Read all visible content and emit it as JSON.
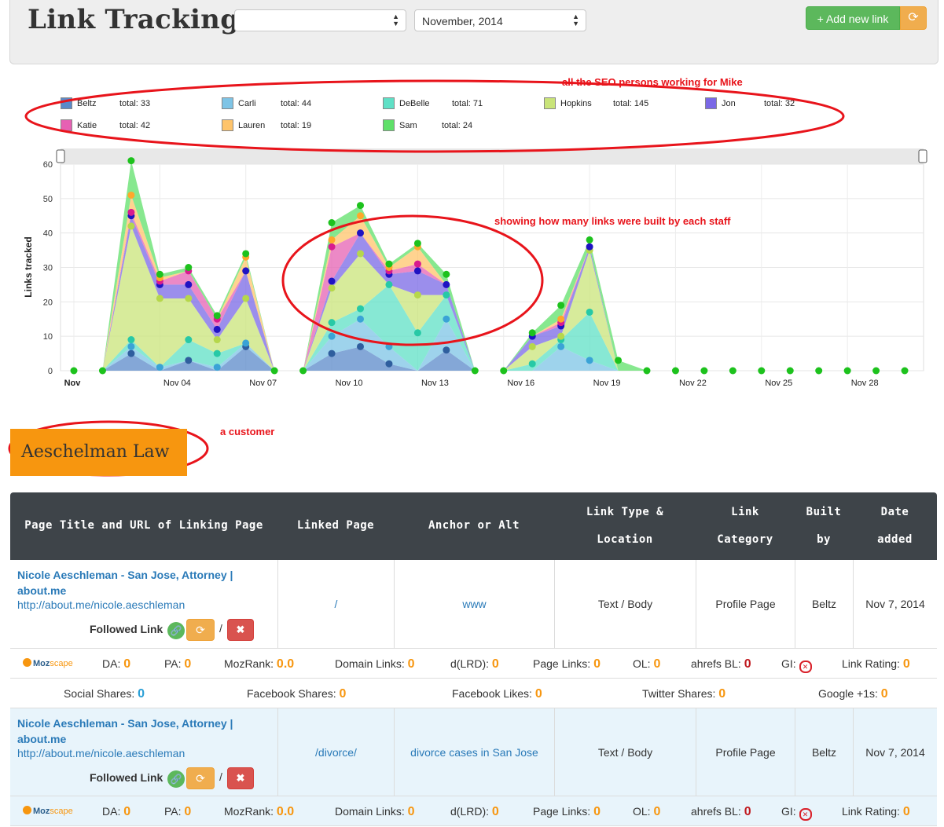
{
  "header": {
    "title": "Link Tracking",
    "select1_value": "",
    "select2_value": "November, 2014",
    "add_button": "+ Add new link",
    "refresh_icon": "refresh-icon"
  },
  "annotations": {
    "seo": "all the SEO persons working for Mike",
    "chart": "showing how many links were built by each staff",
    "customer": "a customer"
  },
  "legend": [
    {
      "name": "Beltz",
      "total": "total: 33",
      "color": "#5b8ac9"
    },
    {
      "name": "Carli",
      "total": "total: 44",
      "color": "#7ec4e6"
    },
    {
      "name": "DeBelle",
      "total": "total: 71",
      "color": "#5fe0c6"
    },
    {
      "name": "Hopkins",
      "total": "total: 145",
      "color": "#c9e479"
    },
    {
      "name": "Jon",
      "total": "total: 32",
      "color": "#7a68e6"
    },
    {
      "name": "Katie",
      "total": "total: 42",
      "color": "#e661b3"
    },
    {
      "name": "Lauren",
      "total": "total: 19",
      "color": "#ffc46b"
    },
    {
      "name": "Sam",
      "total": "total: 24",
      "color": "#5fe069"
    }
  ],
  "chart_data": {
    "type": "area",
    "stacked": true,
    "ylabel": "Links tracked",
    "ylim": [
      0,
      60
    ],
    "yticks": [
      "0",
      "10",
      "20",
      "30",
      "40",
      "50",
      "60"
    ],
    "x_labels": [
      "Nov",
      "Nov 04",
      "Nov 07",
      "Nov 10",
      "Nov 13",
      "Nov 16",
      "Nov 19",
      "Nov 22",
      "Nov 25",
      "Nov 28"
    ],
    "x": [
      "Nov 01",
      "Nov 02",
      "Nov 03",
      "Nov 04",
      "Nov 05",
      "Nov 06",
      "Nov 07",
      "Nov 08",
      "Nov 09",
      "Nov 10",
      "Nov 11",
      "Nov 12",
      "Nov 13",
      "Nov 14",
      "Nov 15",
      "Nov 16",
      "Nov 17",
      "Nov 18",
      "Nov 19",
      "Nov 20",
      "Nov 21",
      "Nov 22",
      "Nov 23",
      "Nov 24",
      "Nov 25",
      "Nov 26",
      "Nov 27",
      "Nov 28",
      "Nov 29",
      "Nov 30"
    ],
    "series": [
      {
        "name": "Beltz",
        "color": "#5b8ac9",
        "values": [
          0,
          0,
          5,
          0,
          3,
          0,
          7,
          0,
          0,
          5,
          7,
          2,
          0,
          6,
          0,
          0,
          0,
          0,
          0,
          0,
          0,
          0,
          0,
          0,
          0,
          0,
          0,
          0,
          0,
          0
        ]
      },
      {
        "name": "Carli",
        "color": "#7ec4e6",
        "values": [
          0,
          0,
          2,
          1,
          0,
          1,
          1,
          0,
          0,
          5,
          8,
          5,
          0,
          9,
          0,
          0,
          0,
          7,
          3,
          0,
          0,
          0,
          0,
          0,
          0,
          0,
          0,
          0,
          0,
          0
        ]
      },
      {
        "name": "DeBelle",
        "color": "#5fe0c6",
        "values": [
          0,
          0,
          2,
          0,
          6,
          4,
          0,
          0,
          0,
          4,
          3,
          18,
          11,
          7,
          0,
          0,
          2,
          2,
          14,
          0,
          0,
          0,
          0,
          0,
          0,
          0,
          0,
          0,
          0,
          0
        ]
      },
      {
        "name": "Hopkins",
        "color": "#c9e479",
        "values": [
          0,
          0,
          33,
          20,
          12,
          4,
          13,
          0,
          0,
          10,
          16,
          0,
          11,
          0,
          0,
          0,
          5,
          1,
          18,
          0,
          0,
          0,
          0,
          0,
          0,
          0,
          0,
          0,
          0,
          0
        ]
      },
      {
        "name": "Jon",
        "color": "#7a68e6",
        "values": [
          0,
          0,
          3,
          4,
          4,
          3,
          8,
          0,
          0,
          2,
          6,
          3,
          7,
          3,
          0,
          0,
          3,
          3,
          1,
          0,
          0,
          0,
          0,
          0,
          0,
          0,
          0,
          0,
          0,
          0
        ]
      },
      {
        "name": "Katie",
        "color": "#e661b3",
        "values": [
          0,
          0,
          1,
          1,
          4,
          3,
          0,
          0,
          0,
          10,
          0,
          1,
          2,
          0,
          0,
          0,
          0,
          1,
          0,
          0,
          0,
          0,
          0,
          0,
          0,
          0,
          0,
          0,
          0,
          0
        ]
      },
      {
        "name": "Lauren",
        "color": "#ffc46b",
        "values": [
          0,
          0,
          5,
          1,
          0,
          0,
          4,
          0,
          0,
          2,
          5,
          1,
          5,
          0,
          0,
          0,
          0,
          1,
          0,
          0,
          0,
          0,
          0,
          0,
          0,
          0,
          0,
          0,
          0,
          0
        ]
      },
      {
        "name": "Sam",
        "color": "#5fe069",
        "values": [
          0,
          0,
          10,
          1,
          1,
          1,
          1,
          0,
          0,
          5,
          3,
          1,
          1,
          3,
          0,
          0,
          1,
          4,
          2,
          3,
          0,
          0,
          0,
          0,
          0,
          0,
          0,
          0,
          0,
          0
        ]
      }
    ]
  },
  "customer": {
    "name": "Aeschelman Law"
  },
  "table": {
    "headers": [
      {
        "l1": "Page Title and URL of Linking Page",
        "l2": ""
      },
      {
        "l1": "Linked Page",
        "l2": ""
      },
      {
        "l1": "Anchor or Alt",
        "l2": ""
      },
      {
        "l1": "Link Type &",
        "l2": "Location"
      },
      {
        "l1": "Link",
        "l2": "Category"
      },
      {
        "l1": "Built",
        "l2": "by"
      },
      {
        "l1": "Date",
        "l2": "added"
      }
    ],
    "rows": [
      {
        "title_line1": "Nicole Aeschleman - San Jose, Attorney |",
        "title_line2": "about.me",
        "url": "http://about.me/nicole.aeschleman",
        "follow": "Followed Link",
        "slash": "/",
        "linked_page": "/",
        "anchor": "www",
        "link_type": "Text / Body",
        "category": "Profile Page",
        "built_by": "Beltz",
        "date": "Nov 7, 2014"
      },
      {
        "title_line1": "Nicole Aeschleman - San Jose, Attorney |",
        "title_line2": "about.me",
        "url": "http://about.me/nicole.aeschleman",
        "follow": "Followed Link",
        "slash": "/",
        "linked_page": "/divorce/",
        "anchor": "divorce cases in San Jose",
        "link_type": "Text / Body",
        "category": "Profile Page",
        "built_by": "Beltz",
        "date": "Nov 7, 2014"
      }
    ],
    "moz_logo": {
      "moz": "Moz",
      "scape": "scape"
    },
    "moz_metrics": [
      {
        "label": "DA:",
        "value": "0"
      },
      {
        "label": "PA:",
        "value": "0"
      },
      {
        "label": "MozRank:",
        "value": "0.0"
      },
      {
        "label": "Domain Links:",
        "value": "0"
      },
      {
        "label": "d(LRD):",
        "value": "0"
      },
      {
        "label": "Page Links:",
        "value": "0"
      },
      {
        "label": "OL:",
        "value": "0"
      },
      {
        "label": "ahrefs BL:",
        "value": "0"
      },
      {
        "label": "GI:",
        "value": ""
      },
      {
        "label": "Link Rating:",
        "value": "0"
      }
    ],
    "social": [
      {
        "label": "Social Shares:",
        "value": "0"
      },
      {
        "label": "Facebook Shares:",
        "value": "0"
      },
      {
        "label": "Facebook Likes:",
        "value": "0"
      },
      {
        "label": "Twitter Shares:",
        "value": "0"
      },
      {
        "label": "Google +1s:",
        "value": "0"
      }
    ]
  }
}
